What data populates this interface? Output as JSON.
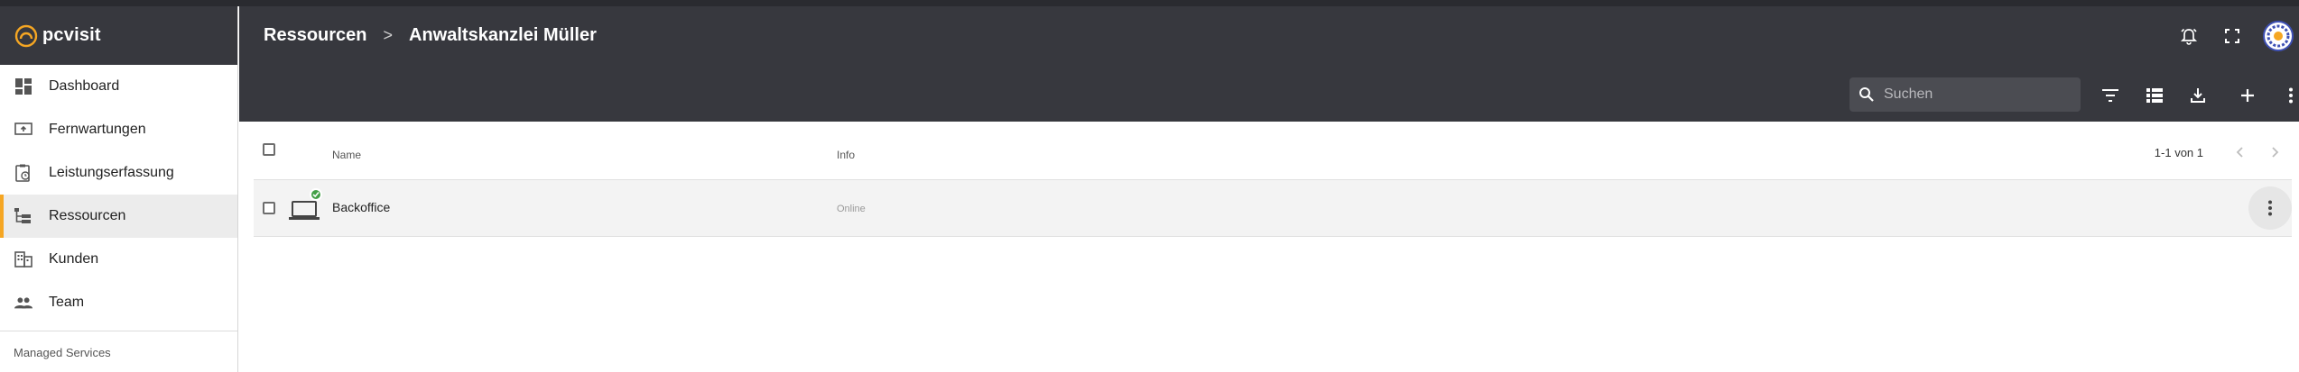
{
  "brand": {
    "name": "pcvisit",
    "logo_icon": "pcvisit-logo-icon",
    "accent": "#f5a623"
  },
  "sidebar": {
    "items": [
      {
        "label": "Dashboard",
        "icon": "dashboard-icon",
        "active": false
      },
      {
        "label": "Fernwartungen",
        "icon": "remote-screen-icon",
        "active": false
      },
      {
        "label": "Leistungserfassung",
        "icon": "clipboard-clock-icon",
        "active": false
      },
      {
        "label": "Ressourcen",
        "icon": "tree-structure-icon",
        "active": true
      },
      {
        "label": "Kunden",
        "icon": "building-icon",
        "active": false
      },
      {
        "label": "Team",
        "icon": "people-icon",
        "active": false
      }
    ],
    "section_label": "Managed Services"
  },
  "header": {
    "breadcrumb": {
      "root": "Ressourcen",
      "current": "Anwaltskanzlei Müller"
    },
    "icons": [
      "alarm-bell-icon",
      "fullscreen-icon",
      "avatar"
    ]
  },
  "toolbar": {
    "search": {
      "placeholder": "Suchen",
      "value": ""
    },
    "icons": [
      "filter-icon",
      "list-view-icon",
      "download-icon",
      "add-icon",
      "more-vert-icon"
    ]
  },
  "table": {
    "columns": {
      "name": "Name",
      "info": "Info"
    },
    "pagination": "1-1 von 1",
    "rows": [
      {
        "name": "Backoffice",
        "info": "Online",
        "status": "online",
        "status_color": "#43a047",
        "icon": "laptop-icon"
      }
    ]
  },
  "colors": {
    "header_bg": "#37383e",
    "search_bg": "#4b4c52",
    "row_bg": "#f3f3f3"
  }
}
